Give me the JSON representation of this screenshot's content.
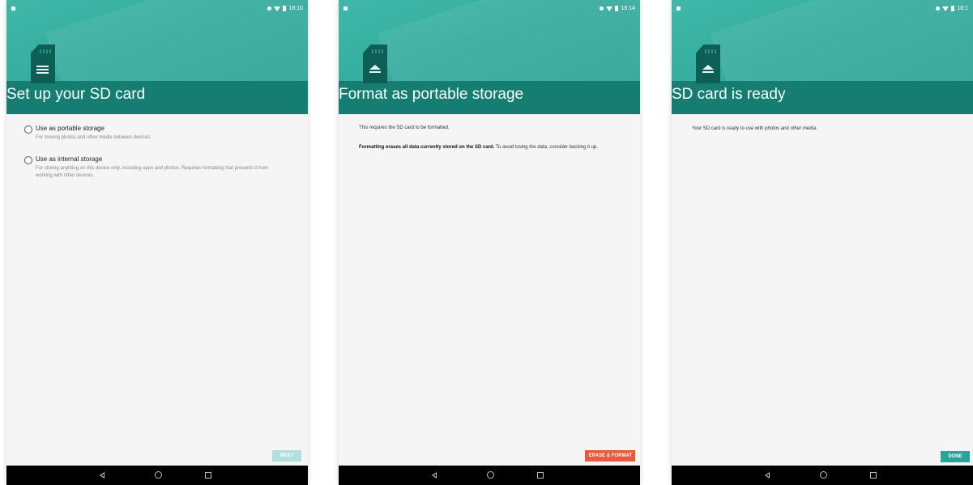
{
  "screens": [
    {
      "status_time": "18:10",
      "title": "Set up your SD card",
      "options": [
        {
          "title": "Use as portable storage",
          "desc": "For moving photos and other media between devices."
        },
        {
          "title": "Use as internal storage",
          "desc": "For storing anything on this device only, including apps and photos. Requires formatting that prevents it from working with other devices."
        }
      ],
      "button_label": "NEXT"
    },
    {
      "status_time": "18:14",
      "title": "Format as portable storage",
      "para1": "This requires the SD card to be formatted.",
      "para2_bold": "Formatting erases all data currently stored on the SD card.",
      "para2_rest": " To avoid losing the data, consider backing it up.",
      "button_label": "ERASE & FORMAT"
    },
    {
      "status_time": "18:1",
      "title": "SD card is ready",
      "para1": "Your SD card is ready to use with photos and other media.",
      "button_label": "DONE"
    }
  ],
  "icons": {
    "card": "sd-card-icon",
    "eject": "eject-icon",
    "back": "back-icon",
    "home": "home-icon",
    "recents": "recents-icon"
  },
  "colors": {
    "header": "#35ad9f",
    "band": "#167d72",
    "erase_button": "#ea5a3a",
    "done_button": "#26a69a",
    "next_button_disabled": "#b2dfdb"
  }
}
